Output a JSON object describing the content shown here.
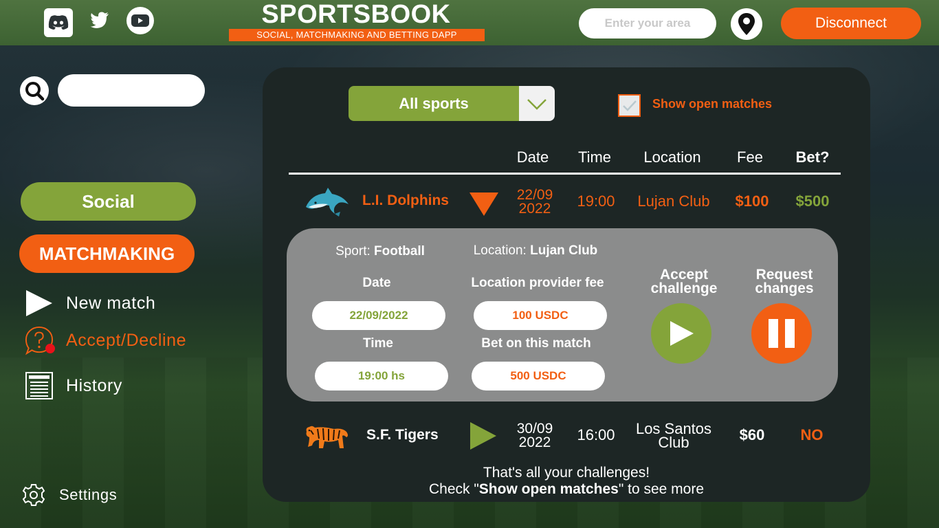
{
  "header": {
    "brand_title": "SPORTSBOOK",
    "brand_subtitle": "SOCIAL, MATCHMAKING AND BETTING DAPP",
    "area_placeholder": "Enter your area",
    "disconnect_label": "Disconnect",
    "social_icons": [
      "discord-icon",
      "twitter-icon",
      "youtube-icon"
    ],
    "location_icon": "map-pin-icon"
  },
  "sidebar": {
    "search_value": "",
    "social_label": "Social",
    "matchmaking_label": "MATCHMAKING",
    "items": [
      {
        "label": "New match",
        "icon": "play-icon"
      },
      {
        "label": "Accept/Decline",
        "icon": "question-bubble-icon",
        "active": true
      },
      {
        "label": "History",
        "icon": "list-icon"
      }
    ],
    "settings_label": "Settings"
  },
  "filters": {
    "sport_selected": "All sports",
    "show_open_label": "Show open matches",
    "show_open_checked": true
  },
  "table": {
    "headers": [
      "Date",
      "Time",
      "Location",
      "Fee",
      "Bet?"
    ],
    "rows": [
      {
        "team": "L.I. Dolphins",
        "date_line1": "22/09",
        "date_line2": "2022",
        "time": "19:00",
        "location": "Lujan Club",
        "fee": "$100",
        "bet": "$500",
        "expanded": true
      },
      {
        "team": "S.F. Tigers",
        "date_line1": "30/09",
        "date_line2": "2022",
        "time": "16:00",
        "location_line1": "Los Santos",
        "location_line2": "Club",
        "fee": "$60",
        "bet": "NO",
        "expanded": false
      }
    ]
  },
  "detail": {
    "sport_label": "Sport:",
    "sport_value": "Football",
    "location_label": "Location:",
    "location_value": "Lujan Club",
    "date_label": "Date",
    "date_value": "22/09/2022",
    "fee_label": "Location provider fee",
    "fee_value": "100 USDC",
    "time_label": "Time",
    "time_value": "19:00 hs",
    "bet_label": "Bet on this match",
    "bet_value": "500 USDC",
    "accept_line1": "Accept",
    "accept_line2": "challenge",
    "request_line1": "Request",
    "request_line2": "changes"
  },
  "footer": {
    "line1": "That's all your challenges!",
    "line2_pre": "Check \"",
    "line2_bold": "Show open matches",
    "line2_post": "\" to see more"
  },
  "colors": {
    "orange": "#f25f13",
    "green": "#84a43a",
    "panel": "#1d2625",
    "detail_card": "#8b8c8c"
  }
}
